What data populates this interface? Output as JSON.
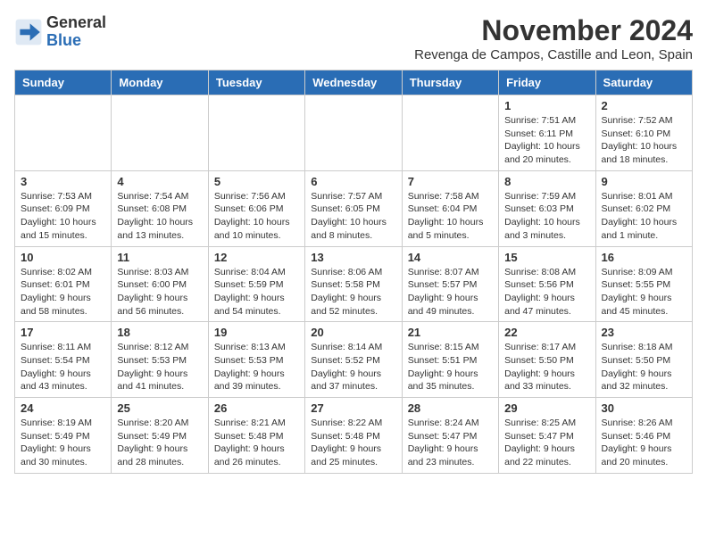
{
  "logo": {
    "line1": "General",
    "line2": "Blue"
  },
  "title": "November 2024",
  "location": "Revenga de Campos, Castille and Leon, Spain",
  "weekdays": [
    "Sunday",
    "Monday",
    "Tuesday",
    "Wednesday",
    "Thursday",
    "Friday",
    "Saturday"
  ],
  "weeks": [
    [
      {
        "day": "",
        "info": ""
      },
      {
        "day": "",
        "info": ""
      },
      {
        "day": "",
        "info": ""
      },
      {
        "day": "",
        "info": ""
      },
      {
        "day": "",
        "info": ""
      },
      {
        "day": "1",
        "info": "Sunrise: 7:51 AM\nSunset: 6:11 PM\nDaylight: 10 hours and 20 minutes."
      },
      {
        "day": "2",
        "info": "Sunrise: 7:52 AM\nSunset: 6:10 PM\nDaylight: 10 hours and 18 minutes."
      }
    ],
    [
      {
        "day": "3",
        "info": "Sunrise: 7:53 AM\nSunset: 6:09 PM\nDaylight: 10 hours and 15 minutes."
      },
      {
        "day": "4",
        "info": "Sunrise: 7:54 AM\nSunset: 6:08 PM\nDaylight: 10 hours and 13 minutes."
      },
      {
        "day": "5",
        "info": "Sunrise: 7:56 AM\nSunset: 6:06 PM\nDaylight: 10 hours and 10 minutes."
      },
      {
        "day": "6",
        "info": "Sunrise: 7:57 AM\nSunset: 6:05 PM\nDaylight: 10 hours and 8 minutes."
      },
      {
        "day": "7",
        "info": "Sunrise: 7:58 AM\nSunset: 6:04 PM\nDaylight: 10 hours and 5 minutes."
      },
      {
        "day": "8",
        "info": "Sunrise: 7:59 AM\nSunset: 6:03 PM\nDaylight: 10 hours and 3 minutes."
      },
      {
        "day": "9",
        "info": "Sunrise: 8:01 AM\nSunset: 6:02 PM\nDaylight: 10 hours and 1 minute."
      }
    ],
    [
      {
        "day": "10",
        "info": "Sunrise: 8:02 AM\nSunset: 6:01 PM\nDaylight: 9 hours and 58 minutes."
      },
      {
        "day": "11",
        "info": "Sunrise: 8:03 AM\nSunset: 6:00 PM\nDaylight: 9 hours and 56 minutes."
      },
      {
        "day": "12",
        "info": "Sunrise: 8:04 AM\nSunset: 5:59 PM\nDaylight: 9 hours and 54 minutes."
      },
      {
        "day": "13",
        "info": "Sunrise: 8:06 AM\nSunset: 5:58 PM\nDaylight: 9 hours and 52 minutes."
      },
      {
        "day": "14",
        "info": "Sunrise: 8:07 AM\nSunset: 5:57 PM\nDaylight: 9 hours and 49 minutes."
      },
      {
        "day": "15",
        "info": "Sunrise: 8:08 AM\nSunset: 5:56 PM\nDaylight: 9 hours and 47 minutes."
      },
      {
        "day": "16",
        "info": "Sunrise: 8:09 AM\nSunset: 5:55 PM\nDaylight: 9 hours and 45 minutes."
      }
    ],
    [
      {
        "day": "17",
        "info": "Sunrise: 8:11 AM\nSunset: 5:54 PM\nDaylight: 9 hours and 43 minutes."
      },
      {
        "day": "18",
        "info": "Sunrise: 8:12 AM\nSunset: 5:53 PM\nDaylight: 9 hours and 41 minutes."
      },
      {
        "day": "19",
        "info": "Sunrise: 8:13 AM\nSunset: 5:53 PM\nDaylight: 9 hours and 39 minutes."
      },
      {
        "day": "20",
        "info": "Sunrise: 8:14 AM\nSunset: 5:52 PM\nDaylight: 9 hours and 37 minutes."
      },
      {
        "day": "21",
        "info": "Sunrise: 8:15 AM\nSunset: 5:51 PM\nDaylight: 9 hours and 35 minutes."
      },
      {
        "day": "22",
        "info": "Sunrise: 8:17 AM\nSunset: 5:50 PM\nDaylight: 9 hours and 33 minutes."
      },
      {
        "day": "23",
        "info": "Sunrise: 8:18 AM\nSunset: 5:50 PM\nDaylight: 9 hours and 32 minutes."
      }
    ],
    [
      {
        "day": "24",
        "info": "Sunrise: 8:19 AM\nSunset: 5:49 PM\nDaylight: 9 hours and 30 minutes."
      },
      {
        "day": "25",
        "info": "Sunrise: 8:20 AM\nSunset: 5:49 PM\nDaylight: 9 hours and 28 minutes."
      },
      {
        "day": "26",
        "info": "Sunrise: 8:21 AM\nSunset: 5:48 PM\nDaylight: 9 hours and 26 minutes."
      },
      {
        "day": "27",
        "info": "Sunrise: 8:22 AM\nSunset: 5:48 PM\nDaylight: 9 hours and 25 minutes."
      },
      {
        "day": "28",
        "info": "Sunrise: 8:24 AM\nSunset: 5:47 PM\nDaylight: 9 hours and 23 minutes."
      },
      {
        "day": "29",
        "info": "Sunrise: 8:25 AM\nSunset: 5:47 PM\nDaylight: 9 hours and 22 minutes."
      },
      {
        "day": "30",
        "info": "Sunrise: 8:26 AM\nSunset: 5:46 PM\nDaylight: 9 hours and 20 minutes."
      }
    ]
  ]
}
